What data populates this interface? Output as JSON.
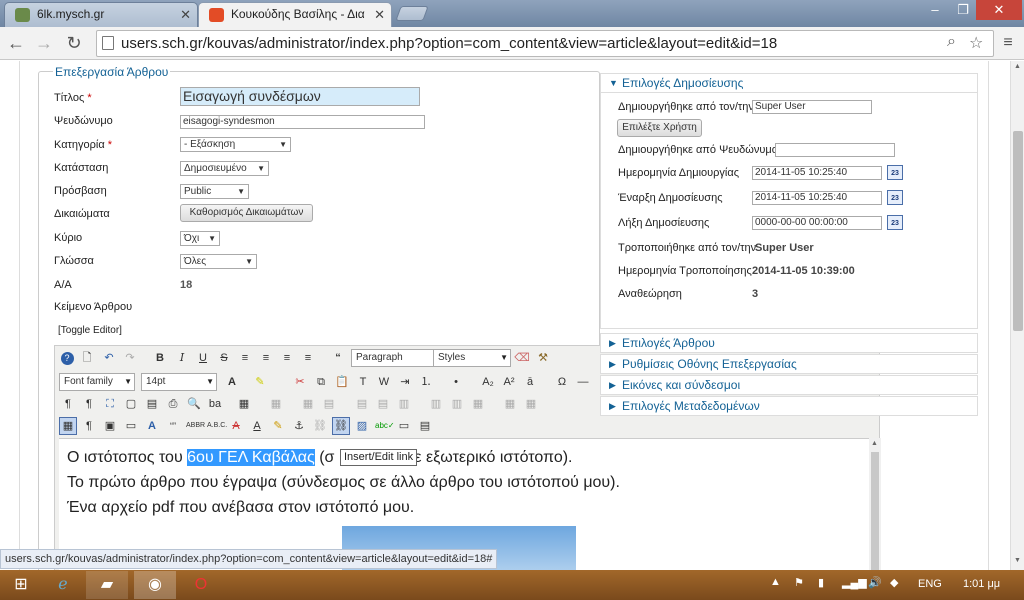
{
  "browser": {
    "tabs": [
      {
        "title": "6lk.mysch.gr",
        "active": false
      },
      {
        "title": "Κουκούδης Βασίλης - Δια",
        "active": true
      }
    ],
    "url": "users.sch.gr/kouvas/administrator/index.php?option=com_content&view=article&layout=edit&id=18",
    "status_url": "users.sch.gr/kouvas/administrator/index.php?option=com_content&view=article&layout=edit&id=18#"
  },
  "form": {
    "legend": "Επεξεργασία Άρθρου",
    "title_label": "Τίτλος",
    "title_value": "Εισαγωγή συνδέσμων",
    "alias_label": "Ψευδώνυμο",
    "alias_value": "eisagogi-syndesmon",
    "category_label": "Κατηγορία",
    "category_value": "- Εξάσκηση",
    "state_label": "Κατάσταση",
    "state_value": "Δημοσιευμένο",
    "access_label": "Πρόσβαση",
    "access_value": "Public",
    "permissions_label": "Δικαιώματα",
    "permissions_button": "Καθορισμός Δικαιωμάτων",
    "featured_label": "Κύριο",
    "featured_value": "Όχι",
    "language_label": "Γλώσσα",
    "language_value": "Όλες",
    "id_label": "Α/Α",
    "id_value": "18",
    "text_label": "Κείμενο Άρθρου",
    "toggle_editor": "[Toggle Editor]"
  },
  "editor": {
    "format_select": "Paragraph",
    "styles_select": "Styles",
    "font_family_select": "Font family",
    "font_size_select": "14pt",
    "content": {
      "line1_before": "Ο ιστότοπος του ",
      "line1_selected": "6ου ΓΕΛ Καβάλας",
      "line1_after": " (σ",
      "line1_tail": "ε εξωτερικό ιστότοπο).",
      "line2": "Το πρώτο άρθρο που έγραψα (σύνδεσμος σε άλλο άρθρο του ιστότοπού μου).",
      "line3": "Ένα αρχείο pdf που ανέβασα στον ιστότοπό μου."
    },
    "tooltip": "Insert/Edit link"
  },
  "publishing": {
    "header": "Επιλογές Δημοσίευσης",
    "created_by_label": "Δημιουργήθηκε από τον/την",
    "created_by_value": "Super User",
    "select_user_button": "Επιλέξτε Χρήστη",
    "created_alias_label": "Δημιουργήθηκε από Ψευδώνυμο",
    "created_date_label": "Ημερομηνία Δημιουργίας",
    "created_date_value": "2014-11-05 10:25:40",
    "publish_up_label": "Έναρξη Δημοσίευσης",
    "publish_up_value": "2014-11-05 10:25:40",
    "publish_down_label": "Λήξη Δημοσίευσης",
    "publish_down_value": "0000-00-00 00:00:00",
    "modified_by_label": "Τροποποιήθηκε από τον/την",
    "modified_by_value": "Super User",
    "modified_date_label": "Ημερομηνία Τροποποίησης",
    "modified_date_value": "2014-11-05 10:39:00",
    "revision_label": "Αναθεώρηση",
    "revision_value": "3",
    "calendar_icon_text": "23"
  },
  "panels": [
    "Επιλογές Άρθρου",
    "Ρυθμίσεις Οθόνης Επεξεργασίας",
    "Εικόνες και σύνδεσμοι",
    "Επιλογές Μεταδεδομένων"
  ],
  "taskbar": {
    "language": "ENG",
    "time": "1:01 μμ"
  },
  "colors": {
    "accent": "#146295",
    "selection": "#3399ff",
    "taskbar": "#8a5a24"
  }
}
